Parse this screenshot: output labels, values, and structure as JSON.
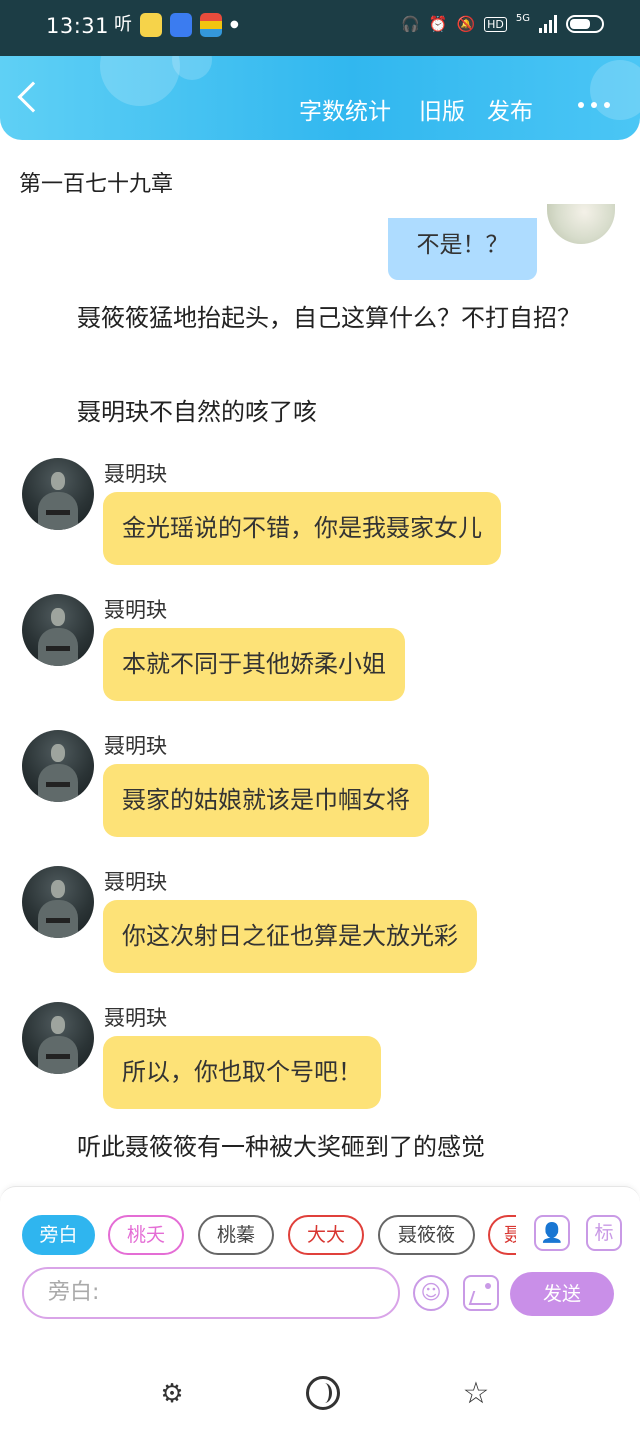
{
  "status_bar": {
    "time": "13:31",
    "app_glyph": "听",
    "network": "5G",
    "hd": "HD",
    "battery": "33",
    "icons": [
      "headphones-icon",
      "alarm-icon",
      "mute-icon",
      "hd-icon",
      "signal-icon",
      "battery-icon"
    ]
  },
  "header": {
    "back_icon": "back-chevron-icon",
    "word_count": "字数统计",
    "old_version": "旧版",
    "publish": "发布",
    "more_icon": "more-dots-icon",
    "gradient": [
      "#5fd0f5",
      "#31b7ef"
    ]
  },
  "content": {
    "chapter_title": "第一百七十九章",
    "top_reply": "不是！？",
    "para1": "聂筱筱猛地抬起头，自己这算什么？不打自招？",
    "para2": "聂明玦不自然的咳了咳",
    "messages": [
      {
        "name": "聂明玦",
        "text": "金光瑶说的不错，你是我聂家女儿"
      },
      {
        "name": "聂明玦",
        "text": "本就不同于其他娇柔小姐"
      },
      {
        "name": "聂明玦",
        "text": "聂家的姑娘就该是巾帼女将"
      },
      {
        "name": "聂明玦",
        "text": "你这次射日之征也算是大放光彩"
      },
      {
        "name": "聂明玦",
        "text": "所以，你也取个号吧！"
      }
    ],
    "para3": "听此聂筱筱有一种被大奖砸到了的感觉"
  },
  "input_panel": {
    "roles": [
      {
        "label": "旁白",
        "style": "active"
      },
      {
        "label": "桃夭",
        "style": "pink"
      },
      {
        "label": "桃蓁",
        "style": "dark"
      },
      {
        "label": "大大",
        "style": "red"
      },
      {
        "label": "聂筱筱",
        "style": "dark"
      },
      {
        "label": "聂",
        "style": "red"
      }
    ],
    "tag_button": "标",
    "input_placeholder": "旁白:",
    "send_label": "发送",
    "accent": "#c98fe8"
  },
  "bottom_nav": {
    "icons": [
      "gift-icon",
      "theme-icon",
      "star-icon"
    ]
  }
}
